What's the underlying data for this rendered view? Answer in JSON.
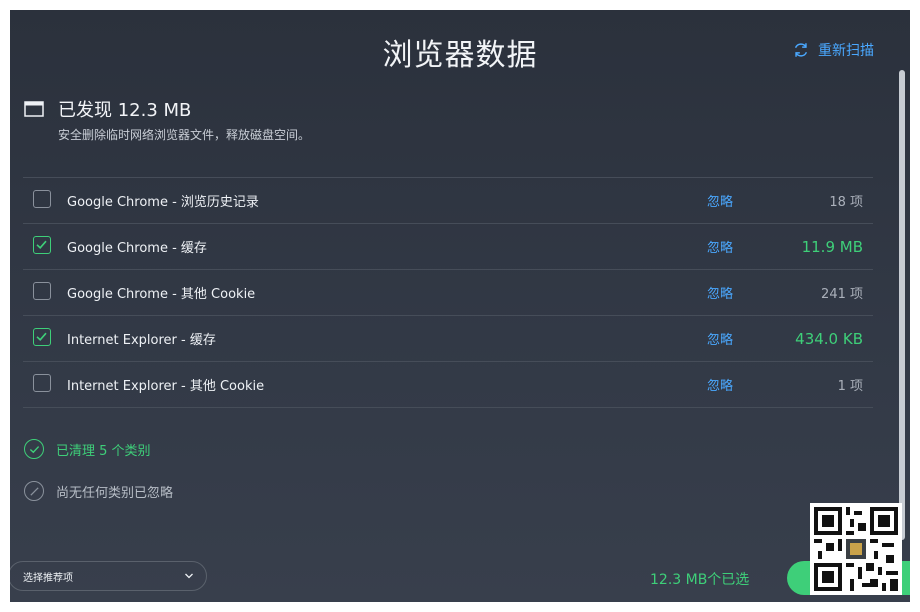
{
  "header": {
    "title": "浏览器数据",
    "rescan_label": "重新扫描"
  },
  "summary": {
    "found_title": "已发现 12.3 MB",
    "found_subtitle": "安全删除临时网络浏览器文件，释放磁盘空间。"
  },
  "items": [
    {
      "label": "Google Chrome - 浏览历史记录",
      "ignore": "忽略",
      "size": "18 项",
      "checked": false
    },
    {
      "label": "Google Chrome - 缓存",
      "ignore": "忽略",
      "size": "11.9 MB",
      "checked": true
    },
    {
      "label": "Google Chrome - 其他 Cookie",
      "ignore": "忽略",
      "size": "241 项",
      "checked": false
    },
    {
      "label": "Internet Explorer - 缓存",
      "ignore": "忽略",
      "size": "434.0 KB",
      "checked": true
    },
    {
      "label": "Internet Explorer - 其他 Cookie",
      "ignore": "忽略",
      "size": "1 项",
      "checked": false
    }
  ],
  "status": {
    "cleaned": "已清理 5 个类别",
    "ignored": "尚无任何类别已忽略"
  },
  "footer": {
    "recommend_label": "选择推荐项",
    "selected_summary": "12.3 MB个已选"
  },
  "colors": {
    "accent_green": "#3ecf79",
    "link_blue": "#4aa8ff",
    "bg": "#2e3440"
  }
}
